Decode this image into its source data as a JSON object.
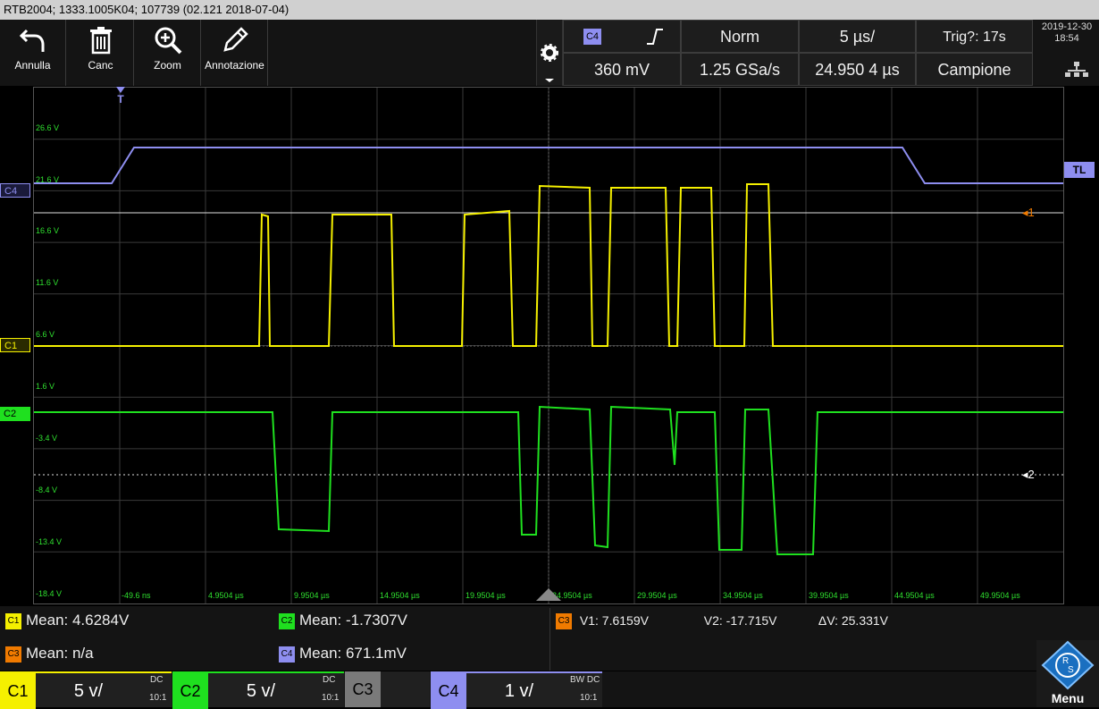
{
  "title": "RTB2004; 1333.1005K04; 107739 (02.121 2018-07-04)",
  "toolbar": {
    "undo": "Annulla",
    "delete": "Canc",
    "zoom": "Zoom",
    "annotate": "Annotazione"
  },
  "trigger_panel": {
    "source": "C4",
    "mode": "Norm",
    "timebase": "5 µs/",
    "trig_status": "Trig?: 17s",
    "level": "360 mV",
    "samplerate": "1.25 GSa/s",
    "position": "24.950 4 µs",
    "acq_mode": "Campione"
  },
  "datetime": {
    "date": "2019-12-30",
    "time": "18:54"
  },
  "y_ticks": [
    "26.6 V",
    "21.6 V",
    "16.6 V",
    "11.6 V",
    "6.6 V",
    "1.6 V",
    "-3.4 V",
    "-8.4 V",
    "-13.4 V",
    "-18.4 V"
  ],
  "x_ticks": [
    "-49.6 ns",
    "4.9504 µs",
    "9.9504 µs",
    "14.9504 µs",
    "19.9504 µs",
    "24.9504 µs",
    "29.9504 µs",
    "34.9504 µs",
    "39.9504 µs",
    "44.9504 µs",
    "49.9504 µs"
  ],
  "markers": {
    "trigger": "T",
    "tl": "TL",
    "cursor1": "1",
    "cursor2": "2",
    "c4": "C4",
    "c1": "C1",
    "c2": "C2"
  },
  "measurements": {
    "c1": {
      "chip": "C1",
      "text": "Mean: 4.6284V"
    },
    "c2": {
      "chip": "C2",
      "text": "Mean: -1.7307V"
    },
    "c3": {
      "chip": "C3",
      "text": "Mean: n/a"
    },
    "c4": {
      "chip": "C4",
      "text": "Mean: 671.1mV"
    },
    "cursor": {
      "chip": "C3",
      "v1": "V1: 7.6159V",
      "v2": "V2: -17.715V",
      "dv": "ΔV: 25.331V"
    }
  },
  "channels": [
    {
      "name": "C1",
      "scale": "5 v/",
      "coupling": "DC",
      "probe": "10:1",
      "color": "#f5f000"
    },
    {
      "name": "C2",
      "scale": "5 v/",
      "coupling": "DC",
      "probe": "10:1",
      "color": "#1fe01f"
    },
    {
      "name": "C3",
      "scale": "",
      "coupling": "",
      "probe": "",
      "color": "#7a7a7a"
    },
    {
      "name": "C4",
      "scale": "1 v/",
      "coupling": "BW DC",
      "probe": "10:1",
      "color": "#8e8ef0"
    }
  ],
  "menu_label": "Menu",
  "colors": {
    "c1": "#f5f000",
    "c2": "#1fe01f",
    "c3": "#f07a00",
    "c4": "#8e8ef0",
    "grid": "#3a3a3a"
  }
}
